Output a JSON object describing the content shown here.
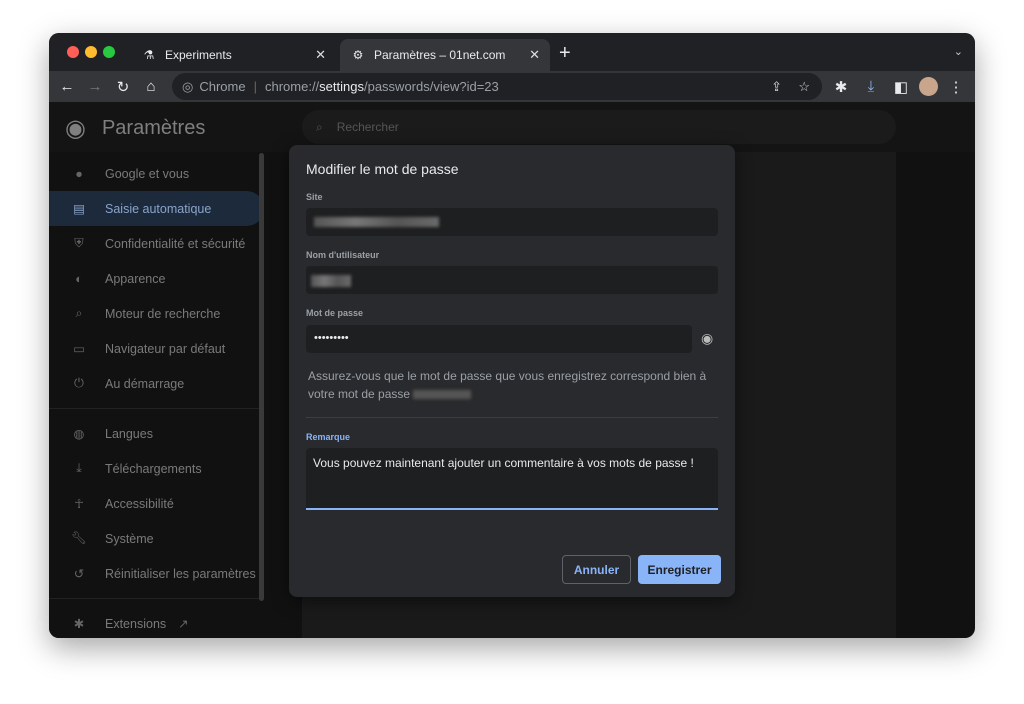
{
  "tabs": [
    {
      "label": "Experiments",
      "icon": "flask-icon"
    },
    {
      "label": "Paramètres – 01net.com",
      "icon": "gear-icon"
    }
  ],
  "omnibox": {
    "chip": "Chrome",
    "url_prefix": "chrome://",
    "url_bold": "settings",
    "url_suffix": "/passwords/view?id=23"
  },
  "header": {
    "title": "Paramètres",
    "search_placeholder": "Rechercher"
  },
  "sidebar": {
    "items": [
      {
        "label": "Google et vous",
        "icon": "person-icon"
      },
      {
        "label": "Saisie automatique",
        "icon": "clipboard-icon",
        "selected": true
      },
      {
        "label": "Confidentialité et sécurité",
        "icon": "shield-icon"
      },
      {
        "label": "Apparence",
        "icon": "palette-icon"
      },
      {
        "label": "Moteur de recherche",
        "icon": "search-icon"
      },
      {
        "label": "Navigateur par défaut",
        "icon": "browser-icon"
      },
      {
        "label": "Au démarrage",
        "icon": "power-icon"
      },
      {
        "label": "Langues",
        "icon": "globe-icon"
      },
      {
        "label": "Téléchargements",
        "icon": "download-icon"
      },
      {
        "label": "Accessibilité",
        "icon": "accessibility-icon"
      },
      {
        "label": "Système",
        "icon": "wrench-icon"
      },
      {
        "label": "Réinitialiser les paramètres",
        "icon": "history-icon"
      },
      {
        "label": "Extensions",
        "icon": "puzzle-icon"
      }
    ]
  },
  "dialog": {
    "title": "Modifier le mot de passe",
    "site_label": "Site",
    "username_label": "Nom d'utilisateur",
    "password_label": "Mot de passe",
    "password_value": "•••••••••",
    "info": "Assurez-vous que le mot de passe que vous enregistrez correspond bien à votre mot de passe",
    "note_label": "Remarque",
    "note_value": "Vous pouvez maintenant ajouter un commentaire à vos mots de passe !",
    "cancel": "Annuler",
    "save": "Enregistrer"
  },
  "colors": {
    "accent": "#8ab4f8",
    "dialog_bg": "#292a2d"
  }
}
